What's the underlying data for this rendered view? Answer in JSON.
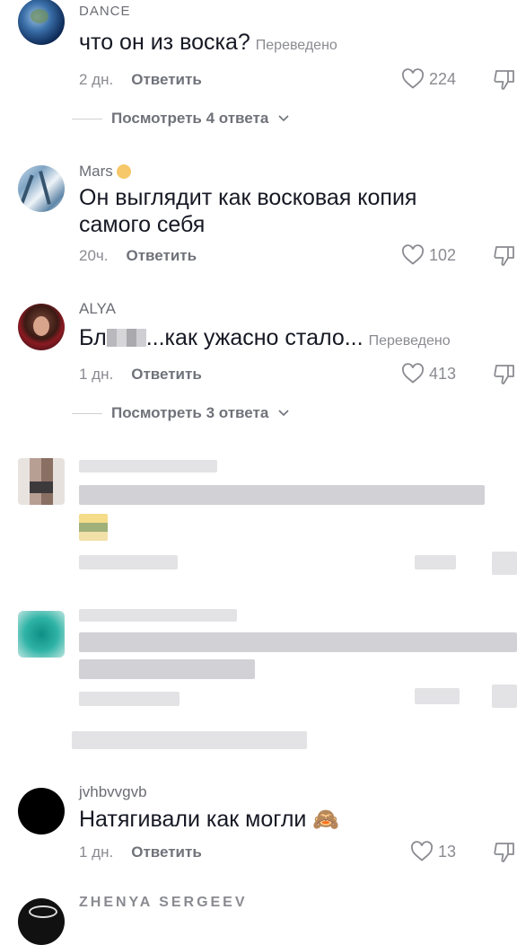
{
  "comments": [
    {
      "username": "DANCE",
      "text": "что он из воска?",
      "translated": "Переведено",
      "time": "2 дн.",
      "reply": "Ответить",
      "likes": "224",
      "view_replies": "Посмотреть 4 ответа"
    },
    {
      "username": "Mars",
      "text_line1": "Он выглядит как восковая копия",
      "text_line2": "самого себя",
      "time": "20ч.",
      "reply": "Ответить",
      "likes": "102"
    },
    {
      "username": "ALYA",
      "text_prefix": "Бл",
      "text_suffix": "...как ужасно стало...",
      "translated": "Переведено",
      "time": "1 дн.",
      "reply": "Ответить",
      "likes": "413",
      "view_replies": "Посмотреть 3 ответа"
    },
    {
      "username": "jvhbvvgvb",
      "text": "Натягивали как могли",
      "emoji": "🙈",
      "time": "1 дн.",
      "reply": "Ответить",
      "likes": "13"
    },
    {
      "username": "ZHENYA SERGEEV"
    }
  ],
  "colors": {
    "text": "#161823",
    "muted": "#8a8b91",
    "reply": "#70727a",
    "badge": "#f6c86a"
  },
  "icons": {
    "like": "heart-icon",
    "dislike": "dislike-icon",
    "expand": "chevron-down-icon"
  }
}
